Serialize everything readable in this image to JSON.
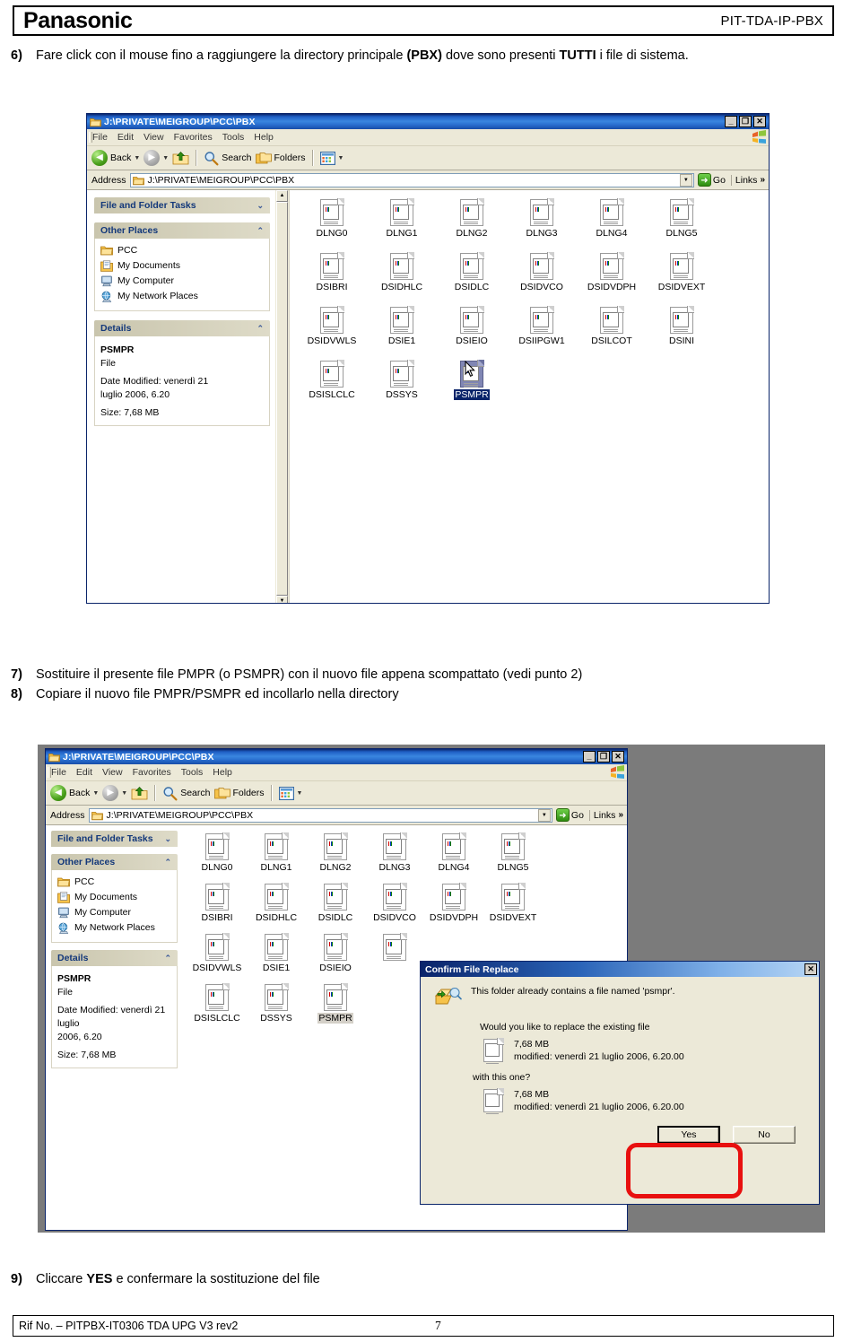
{
  "header": {
    "brand": "Panasonic",
    "model": "PIT-TDA-IP-PBX"
  },
  "steps": {
    "s6": {
      "num": "6)",
      "pre": "Fare click con il mouse fino a raggiungere la directory principale ",
      "b1": "(PBX)",
      "mid": " dove sono presenti ",
      "b2": "TUTTI",
      "post": " i file di sistema."
    },
    "s7": {
      "num": "7)",
      "text": "Sostituire il presente file PMPR (o PSMPR) con il nuovo file appena scompattato (vedi punto 2)"
    },
    "s8": {
      "num": "8)",
      "text": "Copiare il nuovo file PMPR/PSMPR ed incollarlo nella directory"
    },
    "s9": {
      "num": "9)",
      "pre": "Cliccare ",
      "b1": "YES",
      "post": " e confermare la sostituzione del file"
    }
  },
  "footer": {
    "ref": "Rif No. – PITPBX-IT0306 TDA UPG V3 rev2",
    "page": "7"
  },
  "explorer": {
    "title": "J:\\PRIVATE\\MEIGROUP\\PCC\\PBX",
    "window_buttons": {
      "minimize": "_",
      "maximize": "❐",
      "close": "✕"
    },
    "menu": [
      "File",
      "Edit",
      "View",
      "Favorites",
      "Tools",
      "Help"
    ],
    "toolbar": {
      "back": "Back",
      "search": "Search",
      "folders": "Folders"
    },
    "address": {
      "label": "Address",
      "value": "J:\\PRIVATE\\MEIGROUP\\PCC\\PBX",
      "go": "Go",
      "links": "Links",
      "chevron": "»"
    },
    "panels": {
      "tasks": {
        "title": "File and Folder Tasks",
        "chev": "⌄"
      },
      "places": {
        "title": "Other Places",
        "chev": "⌃",
        "items": [
          {
            "label": "PCC",
            "icon": "folder-icon"
          },
          {
            "label": "My Documents",
            "icon": "my-documents-icon"
          },
          {
            "label": "My Computer",
            "icon": "my-computer-icon"
          },
          {
            "label": "My Network Places",
            "icon": "network-places-icon"
          }
        ]
      },
      "details": {
        "title": "Details",
        "chev": "⌃",
        "name": "PSMPR",
        "type": "File",
        "modified": "Date Modified: venerdì 21 luglio 2006, 6.20",
        "modified_l1": "Date Modified: venerdì 21",
        "modified_l2": "luglio 2006, 6.20",
        "modified_b_l1": "Date Modified: venerdì 21 luglio",
        "modified_b_l2": "2006, 6.20",
        "size": "Size: 7,68 MB"
      }
    },
    "files_rows": [
      [
        "DLNG0",
        "DLNG1",
        "DLNG2",
        "DLNG3",
        "DLNG4",
        "DLNG5"
      ],
      [
        "DSIBRI",
        "DSIDHLC",
        "DSIDLC",
        "DSIDVCO",
        "DSIDVDPH",
        "DSIDVEXT"
      ],
      [
        "DSIDVWLS",
        "DSIE1",
        "DSIEIO",
        "DSIIPGW1",
        "DSILCOT",
        "DSINI"
      ],
      [
        "DSISLCLC",
        "DSSYS",
        "PSMPR"
      ]
    ],
    "selected_file": "PSMPR"
  },
  "dialog": {
    "title": "Confirm File Replace",
    "close": "✕",
    "message": "This folder already contains a file named 'psmpr'.",
    "question": "Would you like to replace the existing file",
    "existing": {
      "size": "7,68 MB",
      "modified": "modified: venerdì 21 luglio 2006, 6.20.00"
    },
    "with_this": "with this one?",
    "incoming": {
      "size": "7,68 MB",
      "modified": "modified: venerdì 21 luglio 2006, 6.20.00"
    },
    "yes": "Yes",
    "no": "No"
  },
  "colors": {
    "titlebar_blue": "#0a246a",
    "face": "#ece9d8",
    "selection": "#0a246a",
    "highlight_ring": "#e8100f",
    "desktop": "#7b7b7b"
  }
}
